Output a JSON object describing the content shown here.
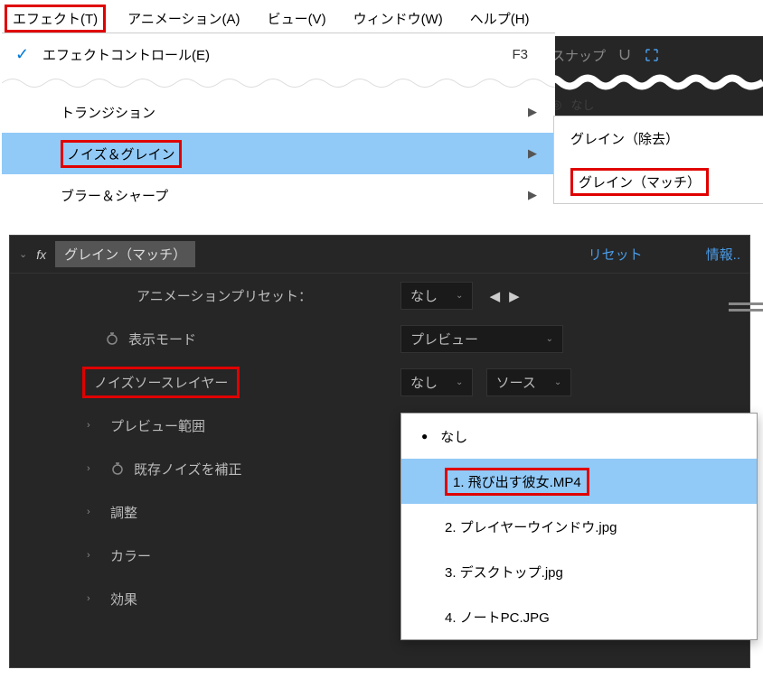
{
  "menubar": {
    "items": [
      "エフェクト(T)",
      "アニメーション(A)",
      "ビュー(V)",
      "ウィンドウ(W)",
      "ヘルプ(H)"
    ]
  },
  "dropdown": {
    "items": [
      {
        "label": "エフェクトコントロール(E)",
        "shortcut": "F3",
        "checked": true
      },
      {
        "label": "トランジション",
        "submenu": true
      },
      {
        "label": "ノイズ＆グレイン",
        "submenu": true,
        "selected": true
      },
      {
        "label": "ブラー＆シャープ",
        "submenu": true
      }
    ]
  },
  "rightPanel": {
    "snap": "スナップ"
  },
  "submenu": {
    "items": [
      "グレイン（除去）",
      "グレイン（マッチ）"
    ]
  },
  "effects": {
    "title": "グレイン（マッチ）",
    "reset": "リセット",
    "info": "情報..",
    "presetLabel": "アニメーションプリセット：",
    "presetValue": "なし",
    "props": [
      {
        "label": "表示モード",
        "value": "プレビュー",
        "stopwatch": true
      },
      {
        "label": "ノイズソースレイヤー",
        "value": "なし",
        "value2": "ソース"
      },
      {
        "label": "プレビュー範囲",
        "expandable": true
      },
      {
        "label": "既存ノイズを補正",
        "stopwatch": true,
        "indent2": true
      },
      {
        "label": "調整",
        "expandable": true
      },
      {
        "label": "カラー",
        "expandable": true
      },
      {
        "label": "効果",
        "expandable": true
      }
    ]
  },
  "layerPopup": {
    "none": "なし",
    "items": [
      "1. 飛び出す彼女.MP4",
      "2. プレイヤーウインドウ.jpg",
      "3. デスクトップ.jpg",
      "4. ノートPC.JPG"
    ]
  }
}
